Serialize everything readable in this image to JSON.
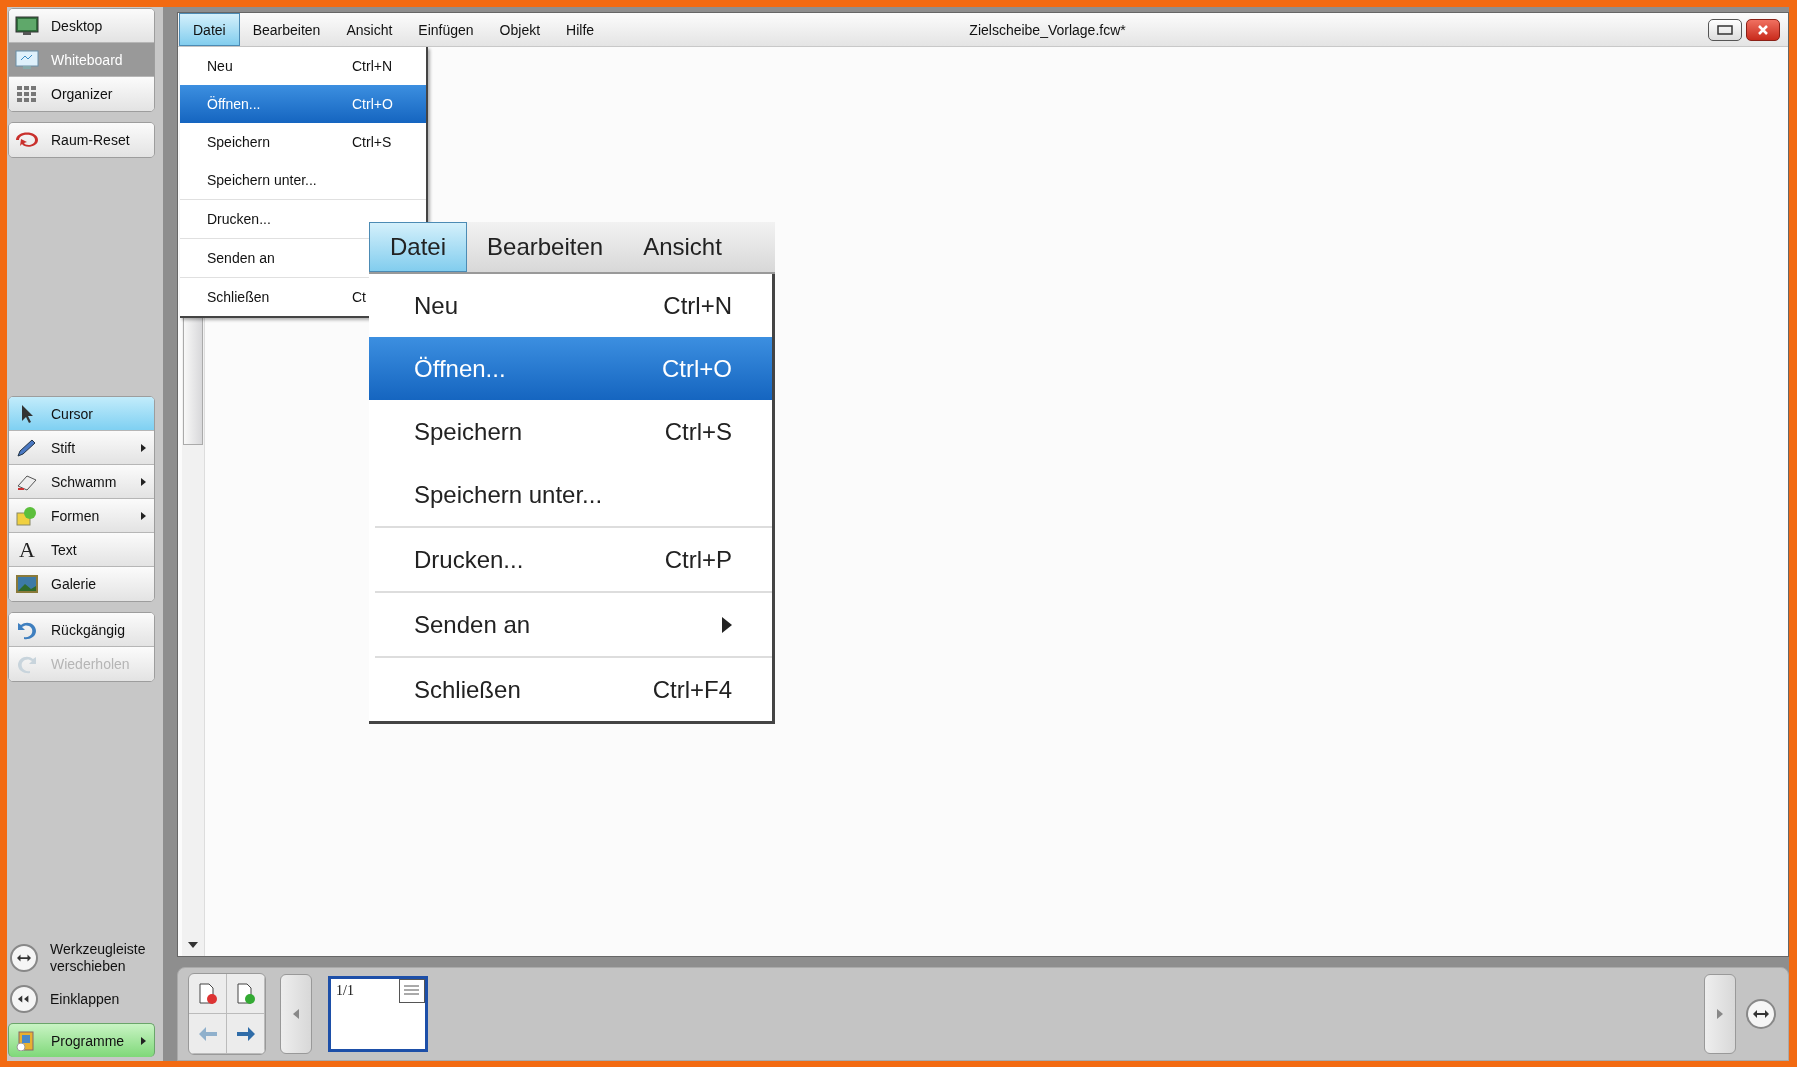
{
  "sidebar": {
    "views": [
      {
        "label": "Desktop",
        "selected": false
      },
      {
        "label": "Whiteboard",
        "selected": true
      },
      {
        "label": "Organizer",
        "selected": false
      }
    ],
    "reset": {
      "label": "Raum-Reset"
    },
    "tools": [
      {
        "label": "Cursor",
        "selected": true,
        "submenu": false
      },
      {
        "label": "Stift",
        "selected": false,
        "submenu": true
      },
      {
        "label": "Schwamm",
        "selected": false,
        "submenu": true
      },
      {
        "label": "Formen",
        "selected": false,
        "submenu": true
      },
      {
        "label": "Text",
        "selected": false,
        "submenu": false,
        "icon_text": "A"
      },
      {
        "label": "Galerie",
        "selected": false,
        "submenu": false
      }
    ],
    "history": [
      {
        "label": "Rückgängig",
        "disabled": false
      },
      {
        "label": "Wiederholen",
        "disabled": true
      }
    ],
    "actions": [
      {
        "label": "Werkzeugleiste verschieben"
      },
      {
        "label": "Einklappen"
      }
    ],
    "programs": {
      "label": "Programme"
    }
  },
  "window": {
    "title": "Zielscheibe_Vorlage.fcw*",
    "menu": [
      {
        "label": "Datei",
        "selected": true
      },
      {
        "label": "Bearbeiten",
        "selected": false
      },
      {
        "label": "Ansicht",
        "selected": false
      },
      {
        "label": "Einfügen",
        "selected": false
      },
      {
        "label": "Objekt",
        "selected": false
      },
      {
        "label": "Hilfe",
        "selected": false
      }
    ]
  },
  "file_menu": {
    "items": [
      {
        "label": "Neu",
        "shortcut": "Ctrl+N",
        "selected": false,
        "separator_before": false
      },
      {
        "label": "Öffnen...",
        "shortcut": "Ctrl+O",
        "selected": true,
        "separator_before": false
      },
      {
        "label": "Speichern",
        "shortcut": "Ctrl+S",
        "selected": false,
        "separator_before": false
      },
      {
        "label": "Speichern unter...",
        "selected": false,
        "separator_before": false
      },
      {
        "label": "Drucken...",
        "selected": false,
        "separator_before": true
      },
      {
        "label": "Senden an",
        "selected": false,
        "separator_before": true
      },
      {
        "label": "Schließen",
        "shortcut": "Ct",
        "selected": false,
        "separator_before": true
      }
    ]
  },
  "zoom_inset": {
    "menu": [
      {
        "label": "Datei",
        "selected": true
      },
      {
        "label": "Bearbeiten",
        "selected": false
      },
      {
        "label": "Ansicht",
        "selected": false
      }
    ],
    "items": [
      {
        "label": "Neu",
        "shortcut": "Ctrl+N",
        "selected": false,
        "separator_before": false,
        "submenu": false
      },
      {
        "label": "Öffnen...",
        "shortcut": "Ctrl+O",
        "selected": true,
        "separator_before": false,
        "submenu": false
      },
      {
        "label": "Speichern",
        "shortcut": "Ctrl+S",
        "selected": false,
        "separator_before": false,
        "submenu": false
      },
      {
        "label": "Speichern unter...",
        "selected": false,
        "separator_before": false,
        "submenu": false
      },
      {
        "label": "Drucken...",
        "shortcut": "Ctrl+P",
        "selected": false,
        "separator_before": true,
        "submenu": false
      },
      {
        "label": "Senden an",
        "selected": false,
        "separator_before": true,
        "submenu": true
      },
      {
        "label": "Schließen",
        "shortcut": "Ctrl+F4",
        "selected": false,
        "separator_before": true,
        "submenu": false
      }
    ]
  },
  "pages": {
    "thumbnail_label": "1/1"
  }
}
